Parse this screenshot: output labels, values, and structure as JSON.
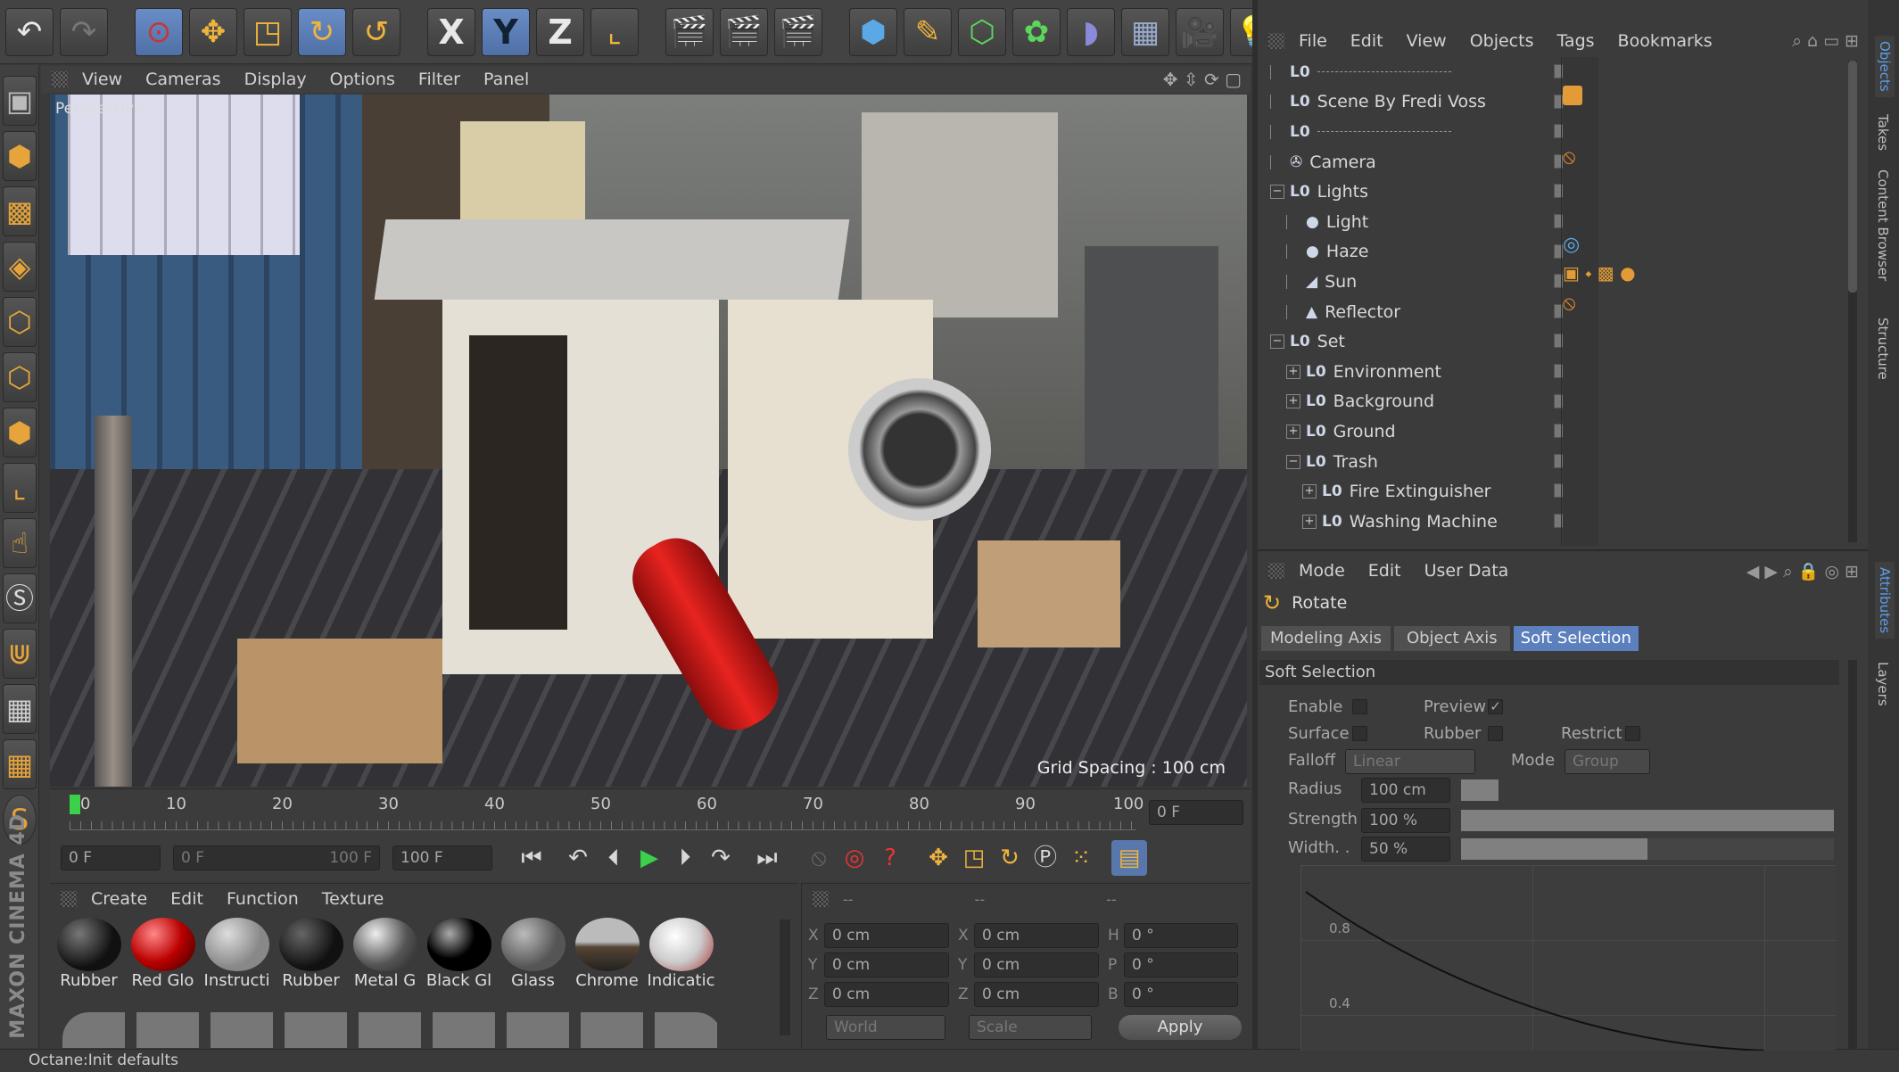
{
  "toolbar": {
    "axis_x": "X",
    "axis_y": "Y",
    "axis_z": "Z"
  },
  "viewport": {
    "menu": [
      "View",
      "Cameras",
      "Display",
      "Options",
      "Filter",
      "Panel"
    ],
    "label": "Perspective",
    "grid_spacing": "Grid Spacing : 100 cm"
  },
  "timeline": {
    "ticks": [
      "0",
      "10",
      "20",
      "30",
      "40",
      "50",
      "60",
      "70",
      "80",
      "90",
      "100"
    ],
    "current_frame": "0 F"
  },
  "playback": {
    "start": "0 F",
    "range_start": "0 F",
    "range_end": "100 F",
    "end": "100 F"
  },
  "materials": {
    "menu": [
      "Create",
      "Edit",
      "Function",
      "Texture"
    ],
    "items": [
      "Rubber",
      "Red Glo",
      "Instructi",
      "Rubber",
      "Metal G",
      "Black Gl",
      "Glass",
      "Chrome",
      "Indicatic"
    ]
  },
  "coords": {
    "header": [
      "--",
      "--",
      "--"
    ],
    "rows": [
      {
        "a": "X",
        "av": "0 cm",
        "b": "X",
        "bv": "0 cm",
        "c": "H",
        "cv": "0 °"
      },
      {
        "a": "Y",
        "av": "0 cm",
        "b": "Y",
        "bv": "0 cm",
        "c": "P",
        "cv": "0 °"
      },
      {
        "a": "Z",
        "av": "0 cm",
        "b": "Z",
        "bv": "0 cm",
        "c": "B",
        "cv": "0 °"
      }
    ],
    "world": "World",
    "scale": "Scale",
    "apply": "Apply"
  },
  "objects": {
    "menu": [
      "File",
      "Edit",
      "View",
      "Objects",
      "Tags",
      "Bookmarks"
    ],
    "rows": [
      {
        "label": "",
        "indent": 0,
        "exp": ""
      },
      {
        "label": "Scene By Fredi Voss",
        "indent": 0,
        "exp": ""
      },
      {
        "label": "",
        "indent": 0,
        "exp": ""
      },
      {
        "label": "Camera",
        "indent": 0,
        "exp": "",
        "ico": "✇"
      },
      {
        "label": "Lights",
        "indent": 0,
        "exp": "−"
      },
      {
        "label": "Light",
        "indent": 1,
        "exp": "",
        "ico": "●"
      },
      {
        "label": "Haze",
        "indent": 1,
        "exp": "",
        "ico": "●"
      },
      {
        "label": "Sun",
        "indent": 1,
        "exp": "",
        "ico": "◢"
      },
      {
        "label": "Reflector",
        "indent": 1,
        "exp": "",
        "ico": "▲"
      },
      {
        "label": "Set",
        "indent": 0,
        "exp": "−"
      },
      {
        "label": "Environment",
        "indent": 1,
        "exp": "+"
      },
      {
        "label": "Background",
        "indent": 1,
        "exp": "+"
      },
      {
        "label": "Ground",
        "indent": 1,
        "exp": "+"
      },
      {
        "label": "Trash",
        "indent": 1,
        "exp": "−"
      },
      {
        "label": "Fire Extinguisher",
        "indent": 2,
        "exp": "+"
      },
      {
        "label": "Washing Machine",
        "indent": 2,
        "exp": "+"
      }
    ]
  },
  "attributes": {
    "menu": [
      "Mode",
      "Edit",
      "User Data"
    ],
    "tool": "Rotate",
    "tabs": [
      "Modeling Axis",
      "Object Axis",
      "Soft Selection"
    ],
    "section": "Soft Selection",
    "enable": "Enable",
    "preview": "Preview",
    "surface": "Surface",
    "rubber": "Rubber",
    "restrict": "Restrict",
    "falloff": "Falloff",
    "falloff_value": "Linear",
    "mode": "Mode",
    "mode_value": "Group",
    "radius": "Radius",
    "radius_value": "100 cm",
    "strength": "Strength",
    "strength_value": "100 %",
    "width": "Width. .",
    "width_value": "50 %",
    "graph_y1": "0.8",
    "graph_y2": "0.4"
  },
  "right_tabs": [
    "Objects",
    "Takes",
    "Content Browser",
    "Structure"
  ],
  "right_tabs2": [
    "Attributes",
    "Layers"
  ],
  "status": "Octane:Init defaults",
  "brand": "MAXON CINEMA 4D"
}
